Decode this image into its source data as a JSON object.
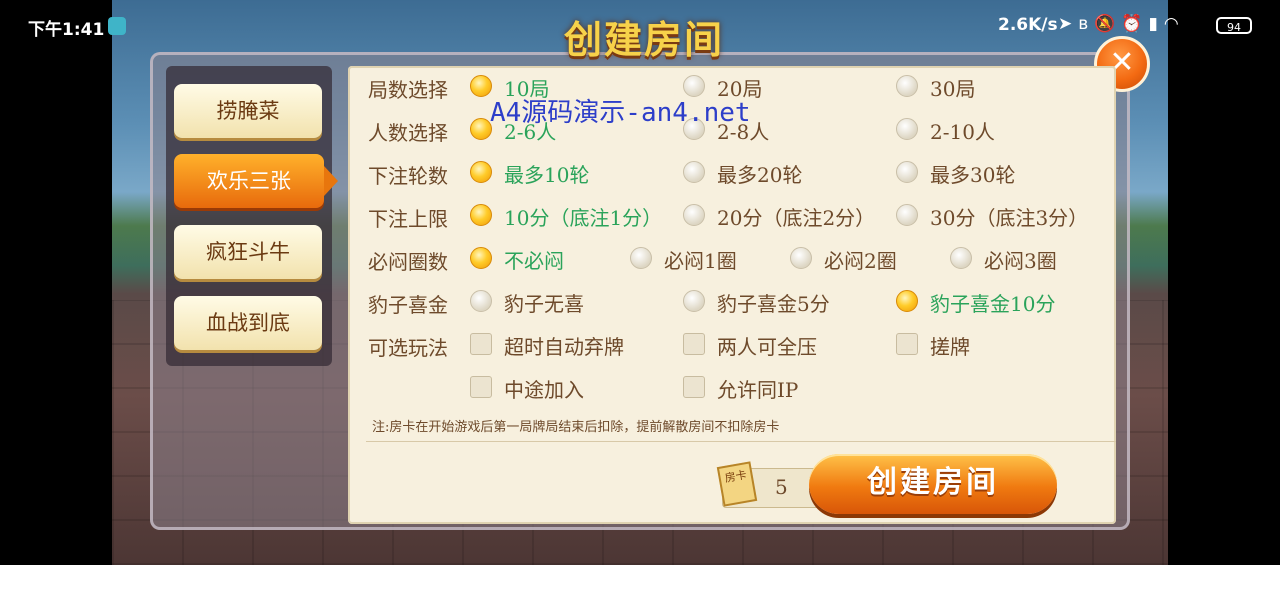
{
  "status_bar": {
    "time": "下午1:41",
    "net_speed": "2.6K/s",
    "icons": [
      "location-arrow-icon",
      "bluetooth-icon",
      "mute-icon",
      "alarm-icon",
      "signal-icon",
      "wifi-icon"
    ],
    "battery": "94"
  },
  "dialog": {
    "title": "创建房间",
    "close_label": "✕"
  },
  "sidebar": {
    "tabs": [
      {
        "label": "捞腌菜",
        "active": false
      },
      {
        "label": "欢乐三张",
        "active": true
      },
      {
        "label": "疯狂斗牛",
        "active": false
      },
      {
        "label": "血战到底",
        "active": false
      }
    ]
  },
  "settings": {
    "rows": [
      {
        "label": "局数选择",
        "type": "radio",
        "options": [
          {
            "text": "10局",
            "selected": true
          },
          {
            "text": "20局",
            "selected": false
          },
          {
            "text": "30局",
            "selected": false
          }
        ]
      },
      {
        "label": "人数选择",
        "type": "radio",
        "options": [
          {
            "text": "2-6人",
            "selected": true
          },
          {
            "text": "2-8人",
            "selected": false
          },
          {
            "text": "2-10人",
            "selected": false
          }
        ]
      },
      {
        "label": "下注轮数",
        "type": "radio",
        "options": [
          {
            "text": "最多10轮",
            "selected": true
          },
          {
            "text": "最多20轮",
            "selected": false
          },
          {
            "text": "最多30轮",
            "selected": false
          }
        ]
      },
      {
        "label": "下注上限",
        "type": "radio",
        "options": [
          {
            "text": "10分（底注1分）",
            "selected": true
          },
          {
            "text": "20分（底注2分）",
            "selected": false
          },
          {
            "text": "30分（底注3分）",
            "selected": false
          }
        ]
      },
      {
        "label": "必闷圈数",
        "type": "radio",
        "options": [
          {
            "text": "不必闷",
            "selected": true
          },
          {
            "text": "必闷1圈",
            "selected": false
          },
          {
            "text": "必闷2圈",
            "selected": false
          },
          {
            "text": "必闷3圈",
            "selected": false
          }
        ]
      },
      {
        "label": "豹子喜金",
        "type": "radio",
        "options": [
          {
            "text": "豹子无喜",
            "selected": false
          },
          {
            "text": "豹子喜金5分",
            "selected": false
          },
          {
            "text": "豹子喜金10分",
            "selected": true
          }
        ]
      },
      {
        "label": "可选玩法",
        "type": "check",
        "options": [
          {
            "text": "超时自动弃牌",
            "checked": false
          },
          {
            "text": "两人可全压",
            "checked": false
          },
          {
            "text": "搓牌",
            "checked": false
          }
        ]
      },
      {
        "label": "",
        "type": "check",
        "options": [
          {
            "text": "中途加入",
            "checked": false
          },
          {
            "text": "允许同IP",
            "checked": false
          }
        ]
      }
    ],
    "note": "注:房卡在开始游戏后第一局牌局结束后扣除，提前解散房间不扣除房卡"
  },
  "footer": {
    "card_icon_label": "房卡",
    "card_count": "5",
    "create_button": "创建房间"
  },
  "watermark": "A4源码演示-an4.net",
  "colors": {
    "accent_orange": "#f07a10",
    "selected_text": "#2aa35a",
    "label_brown": "#6e4a2b",
    "watermark_blue": "#2d3ec9"
  }
}
